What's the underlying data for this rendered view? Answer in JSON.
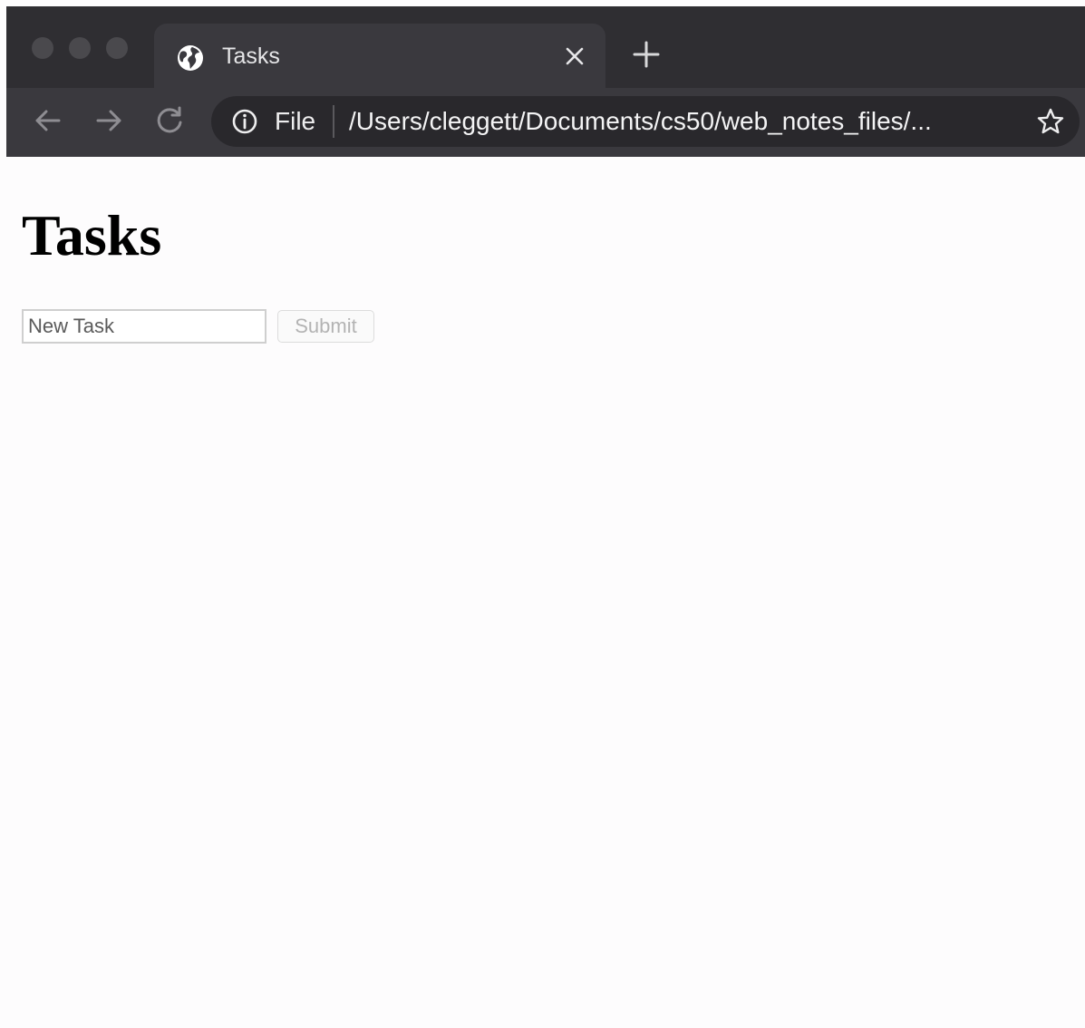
{
  "browser": {
    "tab": {
      "title": "Tasks",
      "favicon": "globe-icon",
      "close_icon": "close-icon"
    },
    "new_tab_icon": "plus-icon",
    "toolbar": {
      "back_icon": "arrow-left-icon",
      "forward_icon": "arrow-right-icon",
      "reload_icon": "reload-icon"
    },
    "omnibox": {
      "info_icon": "info-icon",
      "scheme_label": "File",
      "url": "/Users/cleggett/Documents/cs50/web_notes_files/...",
      "bookmark_icon": "star-icon"
    },
    "colors": {
      "tabstrip": "#2f2e32",
      "toolbar": "#3a393e",
      "omnibox": "#29282c",
      "traffic_light": "#4a494d"
    }
  },
  "page": {
    "title": "Tasks",
    "form": {
      "task_input": {
        "value": "",
        "placeholder": "New Task"
      },
      "submit_label": "Submit"
    },
    "colors": {
      "background": "#fdfcfd",
      "submit_text_disabled": "#b3b3b3"
    }
  }
}
